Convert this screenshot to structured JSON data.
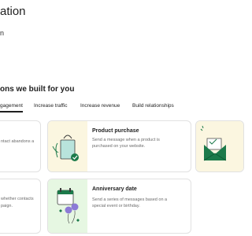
{
  "page": {
    "title": "ation",
    "subtitle": "n"
  },
  "section": {
    "heading": "ons we built for you"
  },
  "tabs": [
    {
      "label": "gagement",
      "active": true
    },
    {
      "label": "Increase traffic",
      "active": false
    },
    {
      "label": "Increase revenue",
      "active": false
    },
    {
      "label": "Build relationships",
      "active": false
    }
  ],
  "cards": {
    "left_top_text": "ntact abandons a",
    "left_bottom_line1": "whether contacts",
    "left_bottom_line2": "paign.",
    "product_purchase": {
      "title": "Product purchase",
      "description": "Send a message when a product is purchased on your website.",
      "icon": "shopping-bag-icon"
    },
    "anniversary_date": {
      "title": "Anniversary date",
      "description": "Send a series of messages based on a special event or birthday.",
      "icon": "calendar-balloons-icon"
    },
    "right_card": {
      "icon": "envelope-icon"
    }
  },
  "colors": {
    "thumb_cream": "#fbf6e0",
    "thumb_mint": "#e6f7e2",
    "accent_green": "#1c7a4a",
    "balloon_purple": "#8c7ad6"
  }
}
